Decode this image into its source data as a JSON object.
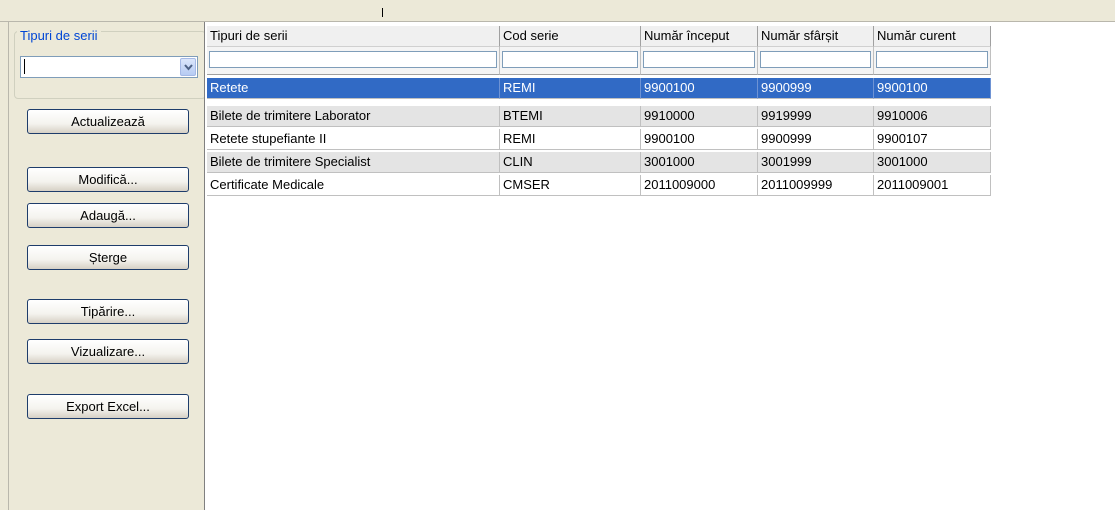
{
  "filter_panel": {
    "legend": "Tipuri de serii",
    "select_value": ""
  },
  "buttons": {
    "refresh": "Actualizează",
    "modify": "Modifică...",
    "add": "Adaugă...",
    "delete": "Șterge",
    "print": "Tipărire...",
    "preview": "Vizualizare...",
    "export": "Export Excel..."
  },
  "grid": {
    "columns": [
      "Tipuri de serii",
      "Cod serie",
      "Număr început",
      "Număr sfârșit",
      "Număr curent"
    ],
    "rows": [
      [
        "Retete",
        "REMI",
        "9900100",
        "9900999",
        "9900100"
      ],
      [
        "Bilete de trimitere Laborator",
        "BTEMI",
        "9910000",
        "9919999",
        "9910006"
      ],
      [
        "Retete stupefiante II",
        "REMI",
        "9900100",
        "9900999",
        "9900107"
      ],
      [
        "Bilete de trimitere Specialist",
        "CLIN",
        "3001000",
        "3001999",
        "3001000"
      ],
      [
        "Certificate Medicale",
        "CMSER",
        "2011009000",
        "2011009999",
        "2011009001"
      ]
    ],
    "selected_row": 0
  },
  "colors": {
    "selected_bg": "#316ac5",
    "alt_row_bg": "#e4e4e4",
    "legend_text": "#0046d5"
  }
}
